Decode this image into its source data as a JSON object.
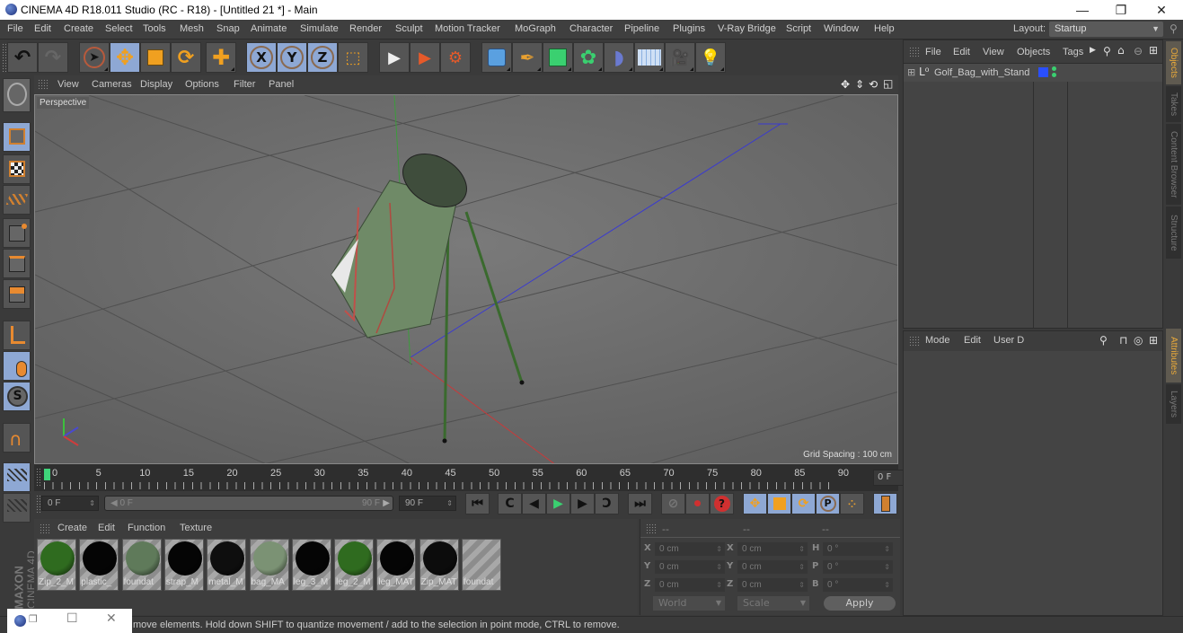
{
  "window": {
    "title": "CINEMA 4D R18.011 Studio (RC - R18) - [Untitled 21 *] - Main",
    "controls": {
      "minimize": "—",
      "restore": "❐",
      "close": "✕"
    }
  },
  "menubar": {
    "items": [
      "File",
      "Edit",
      "Create",
      "Select",
      "Tools",
      "Mesh",
      "Snap",
      "Animate",
      "Simulate",
      "Render",
      "Sculpt",
      "Motion Tracker",
      "MoGraph",
      "Character",
      "Pipeline",
      "Plugins",
      "V-Ray Bridge",
      "Script",
      "Window",
      "Help"
    ],
    "layout_label": "Layout:",
    "layout_value": "Startup"
  },
  "toolbar": {
    "tools": [
      {
        "name": "undo",
        "glyph": "↶"
      },
      {
        "name": "redo",
        "glyph": "↷"
      },
      {
        "name": "live-selection",
        "glyph": "➤"
      },
      {
        "name": "move",
        "glyph": "✥"
      },
      {
        "name": "scale",
        "glyph": "◪"
      },
      {
        "name": "rotate",
        "glyph": "⟳"
      },
      {
        "name": "recent-tool",
        "glyph": "✚"
      },
      {
        "name": "x-axis",
        "glyph": "X"
      },
      {
        "name": "y-axis",
        "glyph": "Y"
      },
      {
        "name": "z-axis",
        "glyph": "Z"
      },
      {
        "name": "coordinate-system",
        "glyph": "⬚"
      },
      {
        "name": "render-view",
        "glyph": "🎬"
      },
      {
        "name": "render-picture-viewer",
        "glyph": "🎬"
      },
      {
        "name": "render-settings",
        "glyph": "🎬"
      },
      {
        "name": "cube",
        "glyph": "■"
      },
      {
        "name": "pen-spline",
        "glyph": "✒"
      },
      {
        "name": "subdivision-surface",
        "glyph": "◆"
      },
      {
        "name": "cloner",
        "glyph": "✿"
      },
      {
        "name": "bend-deformer",
        "glyph": "◗"
      },
      {
        "name": "floor",
        "glyph": "▦"
      },
      {
        "name": "camera",
        "glyph": "🎥"
      },
      {
        "name": "light",
        "glyph": "💡"
      }
    ]
  },
  "viewport": {
    "menu": [
      "View",
      "Cameras",
      "Display",
      "Options",
      "Filter",
      "Panel"
    ],
    "camera_label": "Perspective",
    "grid_spacing": "Grid Spacing : 100 cm",
    "nav_icons": [
      "move-view",
      "zoom-view",
      "rotate-view",
      "maximize-view"
    ]
  },
  "left_tools": [
    "model-mode",
    "texture-mode",
    "workplane-mode",
    "points-mode",
    "edges-mode",
    "polygons-mode",
    "axis-mode",
    "tweak-mode",
    "solo-mode",
    "snap-magnet",
    "lock-workplane",
    "planar-workplane"
  ],
  "timeline": {
    "ticks": [
      "0",
      "5",
      "10",
      "15",
      "20",
      "25",
      "30",
      "35",
      "40",
      "45",
      "50",
      "55",
      "60",
      "65",
      "70",
      "75",
      "80",
      "85",
      "90"
    ],
    "current_frame": "0 F",
    "start_field": "0 F",
    "range_start": "0 F",
    "range_end": "90 F",
    "end_field": "90 F"
  },
  "materials": {
    "menu": [
      "Create",
      "Edit",
      "Function",
      "Texture"
    ],
    "items": [
      {
        "label": "Zip_2_M",
        "color": "#2f6b1f"
      },
      {
        "label": "plastic_",
        "color": "#050505"
      },
      {
        "label": "foundat",
        "color": "#5f7a5a"
      },
      {
        "label": "strap_M",
        "color": "#050505"
      },
      {
        "label": "metal_M",
        "color": "#0e0e0e"
      },
      {
        "label": "bag_MA",
        "color": "#7b9274"
      },
      {
        "label": "leg_3_M",
        "color": "#050505"
      },
      {
        "label": "leg_2_M",
        "color": "#2f6b1f"
      },
      {
        "label": "leg_MAT",
        "color": "#050505"
      },
      {
        "label": "Zip_MAT",
        "color": "#0c0c0c"
      },
      {
        "label": "foundat",
        "color": ""
      }
    ]
  },
  "coordinates": {
    "headers": [
      "--",
      "--",
      "--"
    ],
    "rows": [
      {
        "l1": "X",
        "v1": "0 cm",
        "l2": "X",
        "v2": "0 cm",
        "l3": "H",
        "v3": "0 °"
      },
      {
        "l1": "Y",
        "v1": "0 cm",
        "l2": "Y",
        "v2": "0 cm",
        "l3": "P",
        "v3": "0 °"
      },
      {
        "l1": "Z",
        "v1": "0 cm",
        "l2": "Z",
        "v2": "0 cm",
        "l3": "B",
        "v3": "0 °"
      }
    ],
    "space": "World",
    "mode": "Scale",
    "apply": "Apply"
  },
  "objects_panel": {
    "menu": [
      "File",
      "Edit",
      "View",
      "Objects",
      "Tags"
    ],
    "objects": [
      {
        "name": "Golf_Bag_with_Stand",
        "layer_color": "#2a4fff"
      }
    ]
  },
  "attributes_panel": {
    "menu": [
      "Mode",
      "Edit",
      "User D"
    ]
  },
  "side_tabs": {
    "top": [
      {
        "label": "Objects",
        "active": true
      },
      {
        "label": "Takes",
        "active": false
      },
      {
        "label": "Content Browser",
        "active": false
      },
      {
        "label": "Structure",
        "active": false
      }
    ],
    "bottom": [
      {
        "label": "Attributes",
        "active": true
      },
      {
        "label": "Layers",
        "active": false
      }
    ]
  },
  "brand": {
    "line1": "MAXON",
    "line2": "CINEMA 4D"
  },
  "status": {
    "text": "move elements. Hold down SHIFT to quantize movement / add to the selection in point mode, CTRL to remove."
  }
}
